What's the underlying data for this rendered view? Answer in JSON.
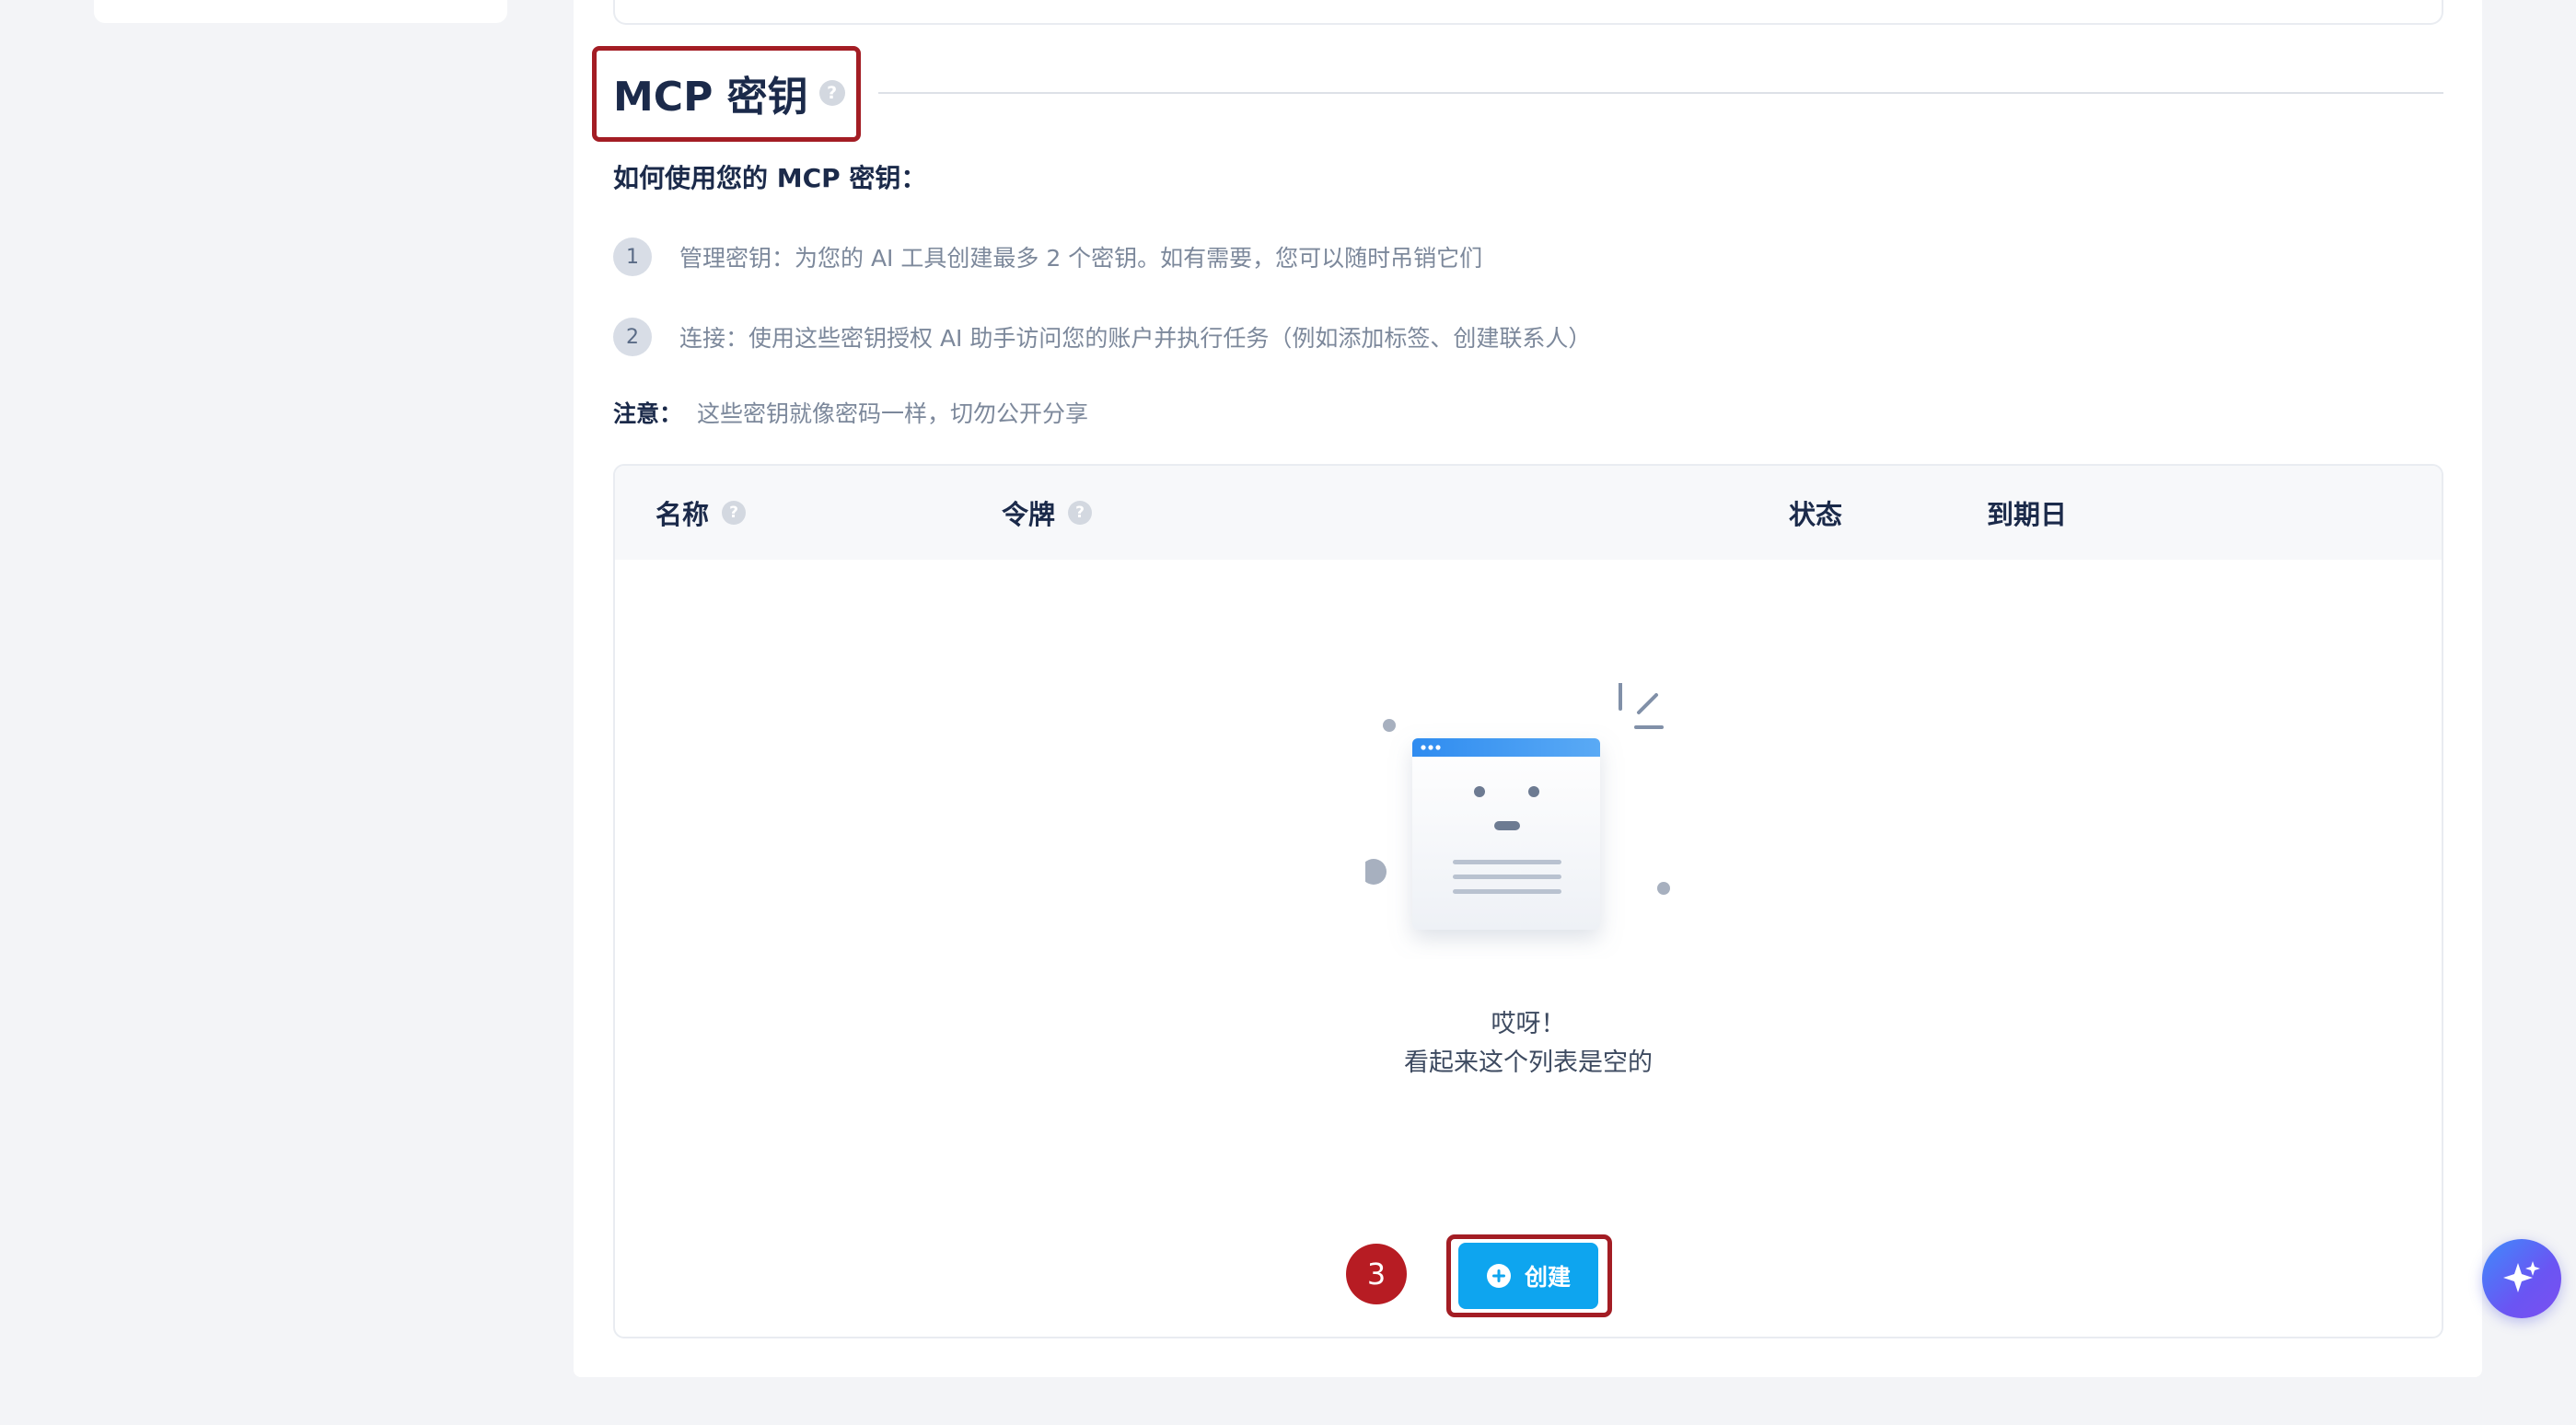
{
  "section": {
    "title": "MCP 密钥",
    "help_glyph": "?"
  },
  "howto": {
    "title": "如何使用您的 MCP 密钥：",
    "steps": [
      {
        "num": "1",
        "text": "管理密钥：为您的 AI 工具创建最多 2 个密钥。如有需要，您可以随时吊销它们"
      },
      {
        "num": "2",
        "text": "连接：使用这些密钥授权 AI 助手访问您的账户并执行任务（例如添加标签、创建联系人）"
      }
    ],
    "note_label": "注意：",
    "note_text": "这些密钥就像密码一样，切勿公开分享"
  },
  "table": {
    "columns": [
      {
        "label": "名称",
        "help": true
      },
      {
        "label": "令牌",
        "help": true
      },
      {
        "label": "状态",
        "help": false
      },
      {
        "label": "到期日",
        "help": false
      }
    ],
    "empty_title": "哎呀！",
    "empty_subtitle": "看起来这个列表是空的"
  },
  "actions": {
    "step_marker": "3",
    "create_label": "创建"
  },
  "colors": {
    "primary": "#0ea5ef",
    "highlight": "#a31d24",
    "marker": "#b71c23",
    "text_dark": "#1b2a4a",
    "text_muted": "#7c889b"
  },
  "icons": {
    "help": "question-circle-icon",
    "create": "plus-circle-icon",
    "ai": "sparkle-icon",
    "empty": "empty-window-icon"
  }
}
